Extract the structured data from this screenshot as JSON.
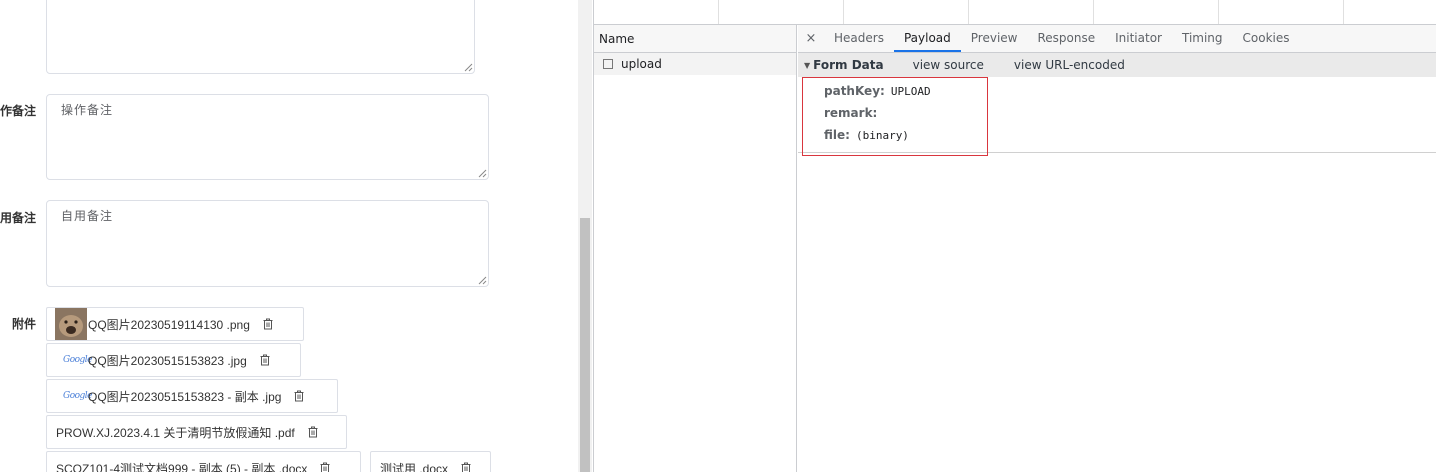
{
  "form": {
    "operation_remark_label": "作备注",
    "operation_remark_value": "操作备注",
    "usage_remark_label": "用备注",
    "usage_remark_value": "自用备注",
    "attachments_label": "附件",
    "attachments": [
      {
        "name": "QQ图片20230519114130 .png",
        "icon": "image-thumbnail"
      },
      {
        "name": "QQ图片20230515153823 .jpg",
        "icon": "google-icon"
      },
      {
        "name": "QQ图片20230515153823 - 副本 .jpg",
        "icon": "google-icon"
      },
      {
        "name": "PROW.XJ.2023.4.1 关于清明节放假通知 .pdf",
        "icon": ""
      },
      {
        "name": "SCQZ101-4测试文档999 - 副本 (5) - 副本 .docx",
        "icon": ""
      },
      {
        "name": "测试用 .docx",
        "icon": ""
      }
    ],
    "google_glyph": "Google"
  },
  "devtools": {
    "list_header": "Name",
    "request_name": "upload",
    "close_symbol": "×",
    "tabs": [
      "Headers",
      "Payload",
      "Preview",
      "Response",
      "Initiator",
      "Timing",
      "Cookies"
    ],
    "active_tab": "Payload",
    "form_data": {
      "title": "Form Data",
      "view_source": "view source",
      "view_url_encoded": "view URL-encoded",
      "fields": [
        {
          "key": "pathKey:",
          "value": "UPLOAD"
        },
        {
          "key": "remark:",
          "value": ""
        },
        {
          "key": "file:",
          "value": "(binary)"
        }
      ]
    }
  },
  "colors": {
    "accent_tab": "#1a73e8",
    "highlight_box": "#d9363e"
  }
}
